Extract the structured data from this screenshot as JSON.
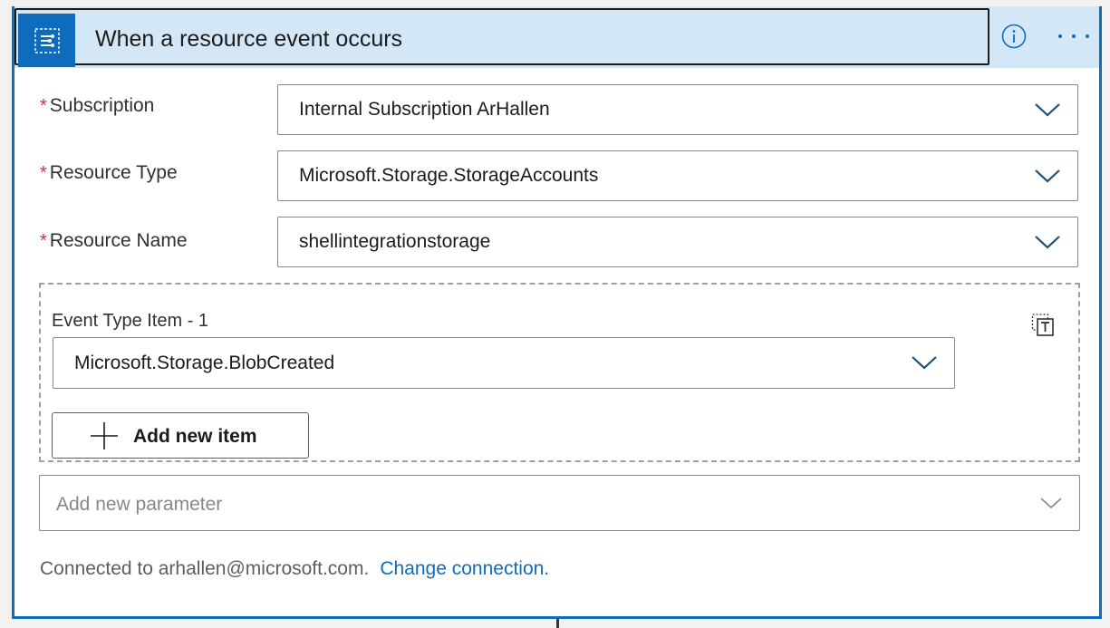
{
  "card": {
    "title": "When a resource event occurs",
    "icon": "event-grid-icon",
    "accent_color": "#0f6cbd",
    "header_color": "#d4e7f6"
  },
  "fields": [
    {
      "label": "Subscription",
      "required_mark": "*",
      "value": "Internal Subscription ArHallen"
    },
    {
      "label": "Resource Type",
      "required_mark": "*",
      "value": "Microsoft.Storage.StorageAccounts"
    },
    {
      "label": "Resource Name",
      "required_mark": "*",
      "value": "shellintegrationstorage"
    }
  ],
  "event_type": {
    "item_label": "Event Type Item - 1",
    "value": "Microsoft.Storage.BlobCreated",
    "add_button_label": "Add new item",
    "switch_icon": "switch-to-text-mode-icon"
  },
  "add_parameter": {
    "placeholder": "Add new parameter"
  },
  "connection": {
    "text": "Connected to arhallen@microsoft.com.",
    "link_label": "Change connection."
  }
}
